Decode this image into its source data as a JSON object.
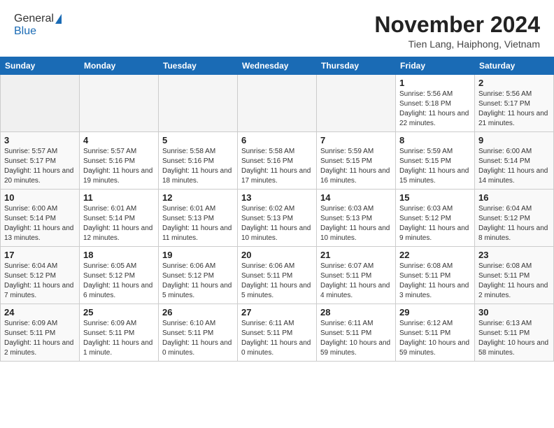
{
  "header": {
    "logo_general": "General",
    "logo_blue": "Blue",
    "month_title": "November 2024",
    "location": "Tien Lang, Haiphong, Vietnam"
  },
  "weekdays": [
    "Sunday",
    "Monday",
    "Tuesday",
    "Wednesday",
    "Thursday",
    "Friday",
    "Saturday"
  ],
  "weeks": [
    [
      {
        "day": "",
        "empty": true
      },
      {
        "day": "",
        "empty": true
      },
      {
        "day": "",
        "empty": true
      },
      {
        "day": "",
        "empty": true
      },
      {
        "day": "",
        "empty": true
      },
      {
        "day": "1",
        "sunrise": "5:56 AM",
        "sunset": "5:18 PM",
        "daylight": "11 hours and 22 minutes."
      },
      {
        "day": "2",
        "sunrise": "5:56 AM",
        "sunset": "5:17 PM",
        "daylight": "11 hours and 21 minutes."
      }
    ],
    [
      {
        "day": "3",
        "sunrise": "5:57 AM",
        "sunset": "5:17 PM",
        "daylight": "11 hours and 20 minutes."
      },
      {
        "day": "4",
        "sunrise": "5:57 AM",
        "sunset": "5:16 PM",
        "daylight": "11 hours and 19 minutes."
      },
      {
        "day": "5",
        "sunrise": "5:58 AM",
        "sunset": "5:16 PM",
        "daylight": "11 hours and 18 minutes."
      },
      {
        "day": "6",
        "sunrise": "5:58 AM",
        "sunset": "5:16 PM",
        "daylight": "11 hours and 17 minutes."
      },
      {
        "day": "7",
        "sunrise": "5:59 AM",
        "sunset": "5:15 PM",
        "daylight": "11 hours and 16 minutes."
      },
      {
        "day": "8",
        "sunrise": "5:59 AM",
        "sunset": "5:15 PM",
        "daylight": "11 hours and 15 minutes."
      },
      {
        "day": "9",
        "sunrise": "6:00 AM",
        "sunset": "5:14 PM",
        "daylight": "11 hours and 14 minutes."
      }
    ],
    [
      {
        "day": "10",
        "sunrise": "6:00 AM",
        "sunset": "5:14 PM",
        "daylight": "11 hours and 13 minutes."
      },
      {
        "day": "11",
        "sunrise": "6:01 AM",
        "sunset": "5:14 PM",
        "daylight": "11 hours and 12 minutes."
      },
      {
        "day": "12",
        "sunrise": "6:01 AM",
        "sunset": "5:13 PM",
        "daylight": "11 hours and 11 minutes."
      },
      {
        "day": "13",
        "sunrise": "6:02 AM",
        "sunset": "5:13 PM",
        "daylight": "11 hours and 10 minutes."
      },
      {
        "day": "14",
        "sunrise": "6:03 AM",
        "sunset": "5:13 PM",
        "daylight": "11 hours and 10 minutes."
      },
      {
        "day": "15",
        "sunrise": "6:03 AM",
        "sunset": "5:12 PM",
        "daylight": "11 hours and 9 minutes."
      },
      {
        "day": "16",
        "sunrise": "6:04 AM",
        "sunset": "5:12 PM",
        "daylight": "11 hours and 8 minutes."
      }
    ],
    [
      {
        "day": "17",
        "sunrise": "6:04 AM",
        "sunset": "5:12 PM",
        "daylight": "11 hours and 7 minutes."
      },
      {
        "day": "18",
        "sunrise": "6:05 AM",
        "sunset": "5:12 PM",
        "daylight": "11 hours and 6 minutes."
      },
      {
        "day": "19",
        "sunrise": "6:06 AM",
        "sunset": "5:12 PM",
        "daylight": "11 hours and 5 minutes."
      },
      {
        "day": "20",
        "sunrise": "6:06 AM",
        "sunset": "5:11 PM",
        "daylight": "11 hours and 5 minutes."
      },
      {
        "day": "21",
        "sunrise": "6:07 AM",
        "sunset": "5:11 PM",
        "daylight": "11 hours and 4 minutes."
      },
      {
        "day": "22",
        "sunrise": "6:08 AM",
        "sunset": "5:11 PM",
        "daylight": "11 hours and 3 minutes."
      },
      {
        "day": "23",
        "sunrise": "6:08 AM",
        "sunset": "5:11 PM",
        "daylight": "11 hours and 2 minutes."
      }
    ],
    [
      {
        "day": "24",
        "sunrise": "6:09 AM",
        "sunset": "5:11 PM",
        "daylight": "11 hours and 2 minutes."
      },
      {
        "day": "25",
        "sunrise": "6:09 AM",
        "sunset": "5:11 PM",
        "daylight": "11 hours and 1 minute."
      },
      {
        "day": "26",
        "sunrise": "6:10 AM",
        "sunset": "5:11 PM",
        "daylight": "11 hours and 0 minutes."
      },
      {
        "day": "27",
        "sunrise": "6:11 AM",
        "sunset": "5:11 PM",
        "daylight": "11 hours and 0 minutes."
      },
      {
        "day": "28",
        "sunrise": "6:11 AM",
        "sunset": "5:11 PM",
        "daylight": "10 hours and 59 minutes."
      },
      {
        "day": "29",
        "sunrise": "6:12 AM",
        "sunset": "5:11 PM",
        "daylight": "10 hours and 59 minutes."
      },
      {
        "day": "30",
        "sunrise": "6:13 AM",
        "sunset": "5:11 PM",
        "daylight": "10 hours and 58 minutes."
      }
    ]
  ],
  "labels": {
    "sunrise": "Sunrise:",
    "sunset": "Sunset:",
    "daylight": "Daylight:"
  }
}
